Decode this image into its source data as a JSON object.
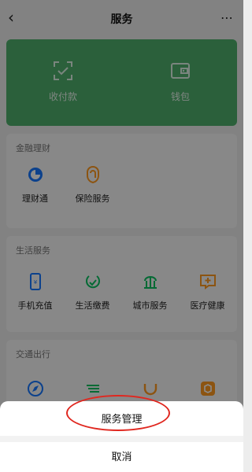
{
  "header": {
    "back_icon": "chevron-left-icon",
    "title": "服务",
    "more_icon": "more-dots-icon"
  },
  "wallet_card": {
    "color": "#4fb06c",
    "items": [
      {
        "label": "收付款",
        "icon": "scan-check-icon"
      },
      {
        "label": "钱包",
        "icon": "wallet-icon"
      }
    ]
  },
  "sections": [
    {
      "title": "金融理财",
      "items": [
        {
          "label": "理财通",
          "icon": "licaitong-icon"
        },
        {
          "label": "保险服务",
          "icon": "insurance-icon"
        }
      ]
    },
    {
      "title": "生活服务",
      "items": [
        {
          "label": "手机充值",
          "icon": "phone-recharge-icon"
        },
        {
          "label": "生活缴费",
          "icon": "bill-payment-icon"
        },
        {
          "label": "城市服务",
          "icon": "city-services-icon"
        },
        {
          "label": "医疗健康",
          "icon": "medical-health-icon"
        }
      ]
    },
    {
      "title": "交通出行",
      "items": [
        {
          "label": "",
          "icon": "compass-icon"
        },
        {
          "label": "",
          "icon": "train-icon"
        },
        {
          "label": "",
          "icon": "didi-icon"
        },
        {
          "label": "",
          "icon": "hotel-icon"
        }
      ]
    }
  ],
  "action_sheet": {
    "manage_label": "服务管理",
    "cancel_label": "取消"
  },
  "colors": {
    "overlay": "rgba(0,0,0,0.45)",
    "highlight": "#e0271f",
    "icon_blue": "#1677ff",
    "icon_green": "#07c160",
    "icon_orange": "#ff9a1f"
  }
}
